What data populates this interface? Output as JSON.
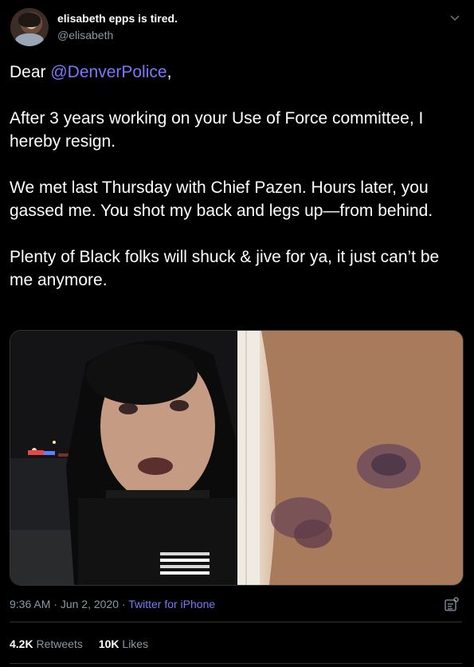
{
  "author": {
    "display_name": "elisabeth epps is tired.",
    "handle": "@elisabeth"
  },
  "tweet": {
    "greeting_prefix": "Dear ",
    "mention": "@DenverPolice",
    "greeting_suffix": ",",
    "body": "\n\nAfter 3 years working on your Use of Force committee, I hereby resign.\n\nWe met last Thursday with Chief Pazen. Hours later, you gassed me. You shot my back and legs up—from behind.\n\nPlenty of Black folks will shuck & jive for ya, it just can’t be me anymore."
  },
  "meta": {
    "time": "9:36 AM",
    "separator": " · ",
    "date": "Jun 2, 2020",
    "separator2": " · ",
    "source": "Twitter for iPhone"
  },
  "stats": {
    "retweets_count": "4.2K",
    "retweets_label": "Retweets",
    "likes_count": "10K",
    "likes_label": "Likes"
  },
  "colors": {
    "background": "#000000",
    "accent": "#7b76ff",
    "secondary_text": "#8899a6"
  },
  "icons": {
    "caret": "chevron-down-icon",
    "dashboard": "tweet-activity-icon"
  }
}
